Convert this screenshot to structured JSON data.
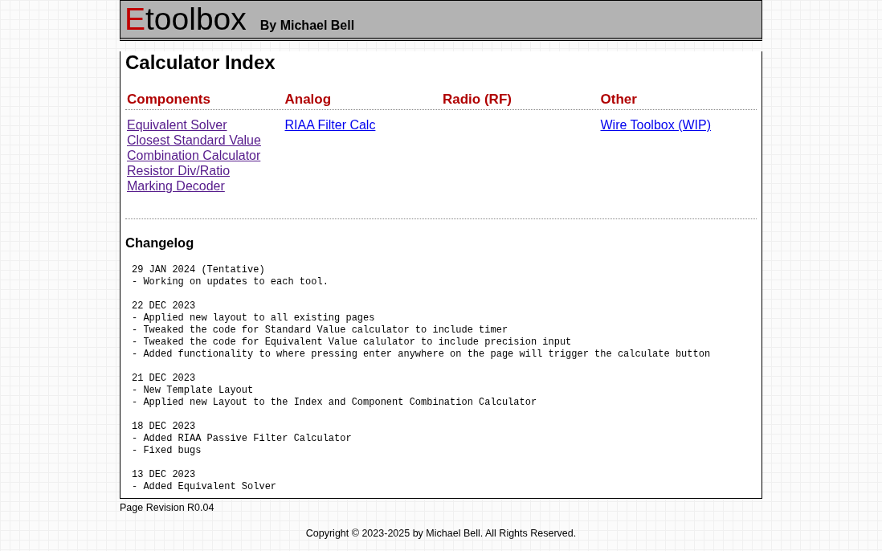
{
  "header": {
    "logo": {
      "accent": "E",
      "text": "toolbox"
    },
    "byline": "By Michael Bell"
  },
  "index": {
    "title": "Calculator Index",
    "categories": [
      {
        "title": "Components",
        "links": [
          {
            "label": "Equivalent Solver",
            "visited": true
          },
          {
            "label": "Closest Standard Value",
            "visited": true
          },
          {
            "label": "Combination Calculator",
            "visited": true
          },
          {
            "label": "Resistor Div/Ratio",
            "visited": true
          },
          {
            "label": "Marking Decoder",
            "visited": true
          }
        ]
      },
      {
        "title": "Analog",
        "links": [
          {
            "label": "RIAA Filter Calc",
            "visited": false
          }
        ]
      },
      {
        "title": "Radio (RF)"
      },
      {
        "title": "Other",
        "links": [
          {
            "label": "Wire Toolbox (WIP)",
            "visited": false
          }
        ]
      }
    ]
  },
  "changelog": {
    "title": "Changelog",
    "entries": [
      {
        "date": "29 JAN 2024 (Tentative)",
        "lines": [
          "- Working on updates to each tool."
        ]
      },
      {
        "date": "22 DEC 2023",
        "lines": [
          "- Applied new layout to all existing pages",
          "- Tweaked the code for Standard Value calculator to include timer",
          "- Tweaked the code for Equivalent Value calulator to include precision input",
          "- Added functionality to where pressing enter anywhere on the page will trigger the calculate button"
        ]
      },
      {
        "date": "21 DEC 2023",
        "lines": [
          "- New Template Layout",
          "- Applied new Layout to the Index and Component Combination Calculator"
        ]
      },
      {
        "date": "18 DEC 2023",
        "lines": [
          "- Added RIAA Passive Filter Calculator",
          "- Fixed bugs"
        ]
      },
      {
        "date": "13 DEC 2023",
        "lines": [
          "- Added Equivalent Solver"
        ]
      }
    ]
  },
  "revision": "Page Revision R0.04",
  "copyright": "Copyright © 2023-2025 by Michael Bell. All Rights Reserved."
}
